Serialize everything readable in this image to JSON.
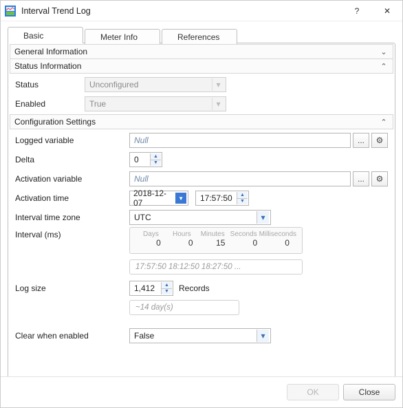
{
  "window": {
    "title": "Interval Trend Log",
    "help_symbol": "?",
    "close_symbol": "✕"
  },
  "tabs": {
    "basic": "Basic",
    "meter_info": "Meter Info",
    "references": "References"
  },
  "sections": {
    "general": "General Information",
    "status": "Status Information",
    "config": "Configuration Settings"
  },
  "status": {
    "status_label": "Status",
    "status_value": "Unconfigured",
    "enabled_label": "Enabled",
    "enabled_value": "True"
  },
  "config": {
    "logged_var_label": "Logged variable",
    "logged_var_value": "Null",
    "delta_label": "Delta",
    "delta_value": "0",
    "activation_var_label": "Activation variable",
    "activation_var_value": "Null",
    "activation_time_label": "Activation time",
    "activation_date_value": "2018-12-07",
    "activation_clock_value": "17:57:50",
    "interval_tz_label": "Interval time zone",
    "interval_tz_value": "UTC",
    "interval_ms_label": "Interval (ms)",
    "interval_headers": {
      "days": "Days",
      "hours": "Hours",
      "minutes": "Minutes",
      "seconds": "Seconds",
      "ms": "Milliseconds"
    },
    "interval_values": {
      "days": "0",
      "hours": "0",
      "minutes": "15",
      "seconds": "0",
      "ms": "0"
    },
    "interval_preview": "17:57:50  18:12:50  18:27:50 ...",
    "log_size_label": "Log size",
    "log_size_value": "1,412",
    "log_size_unit": "Records",
    "log_size_hint": "~14 day(s)",
    "clear_when_enabled_label": "Clear when enabled",
    "clear_when_enabled_value": "False",
    "browse_symbol": "...",
    "gear_symbol": "⚙"
  },
  "footer": {
    "ok": "OK",
    "close": "Close"
  },
  "chevron": {
    "down": "⌄",
    "up": "⌃"
  }
}
